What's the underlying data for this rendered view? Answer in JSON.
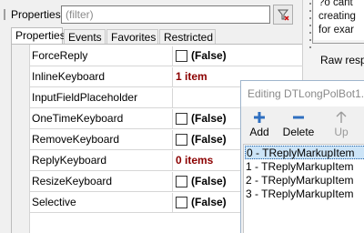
{
  "inspector": {
    "title": "Properties",
    "filter_placeholder": "(filter)",
    "tabs": [
      {
        "label": "Properties",
        "active": true
      },
      {
        "label": "Events",
        "active": false
      },
      {
        "label": "Favorites",
        "active": false
      },
      {
        "label": "Restricted",
        "active": false
      }
    ],
    "rows": [
      {
        "name": "ForceReply",
        "checkbox": true,
        "value": "(False)"
      },
      {
        "name": "InlineKeyboard",
        "checkbox": false,
        "value": "1 item"
      },
      {
        "name": "InputFieldPlaceholder",
        "checkbox": false,
        "value": ""
      },
      {
        "name": "OneTimeKeyboard",
        "checkbox": true,
        "value": "(False)"
      },
      {
        "name": "RemoveKeyboard",
        "checkbox": true,
        "value": "(False)"
      },
      {
        "name": "ReplyKeyboard",
        "checkbox": false,
        "value": "0 items"
      },
      {
        "name": "ResizeKeyboard",
        "checkbox": true,
        "value": "(False)"
      },
      {
        "name": "Selective",
        "checkbox": true,
        "value": "(False)"
      }
    ],
    "colors": {
      "item_count": "#8b0000"
    }
  },
  "background": {
    "memo_lines": [
      "?o cant",
      "creating",
      "for exar"
    ],
    "raw_label": "Raw resp"
  },
  "editor": {
    "title": "Editing DTLongPolBot1.Re",
    "toolbar": {
      "add_label": "Add",
      "delete_label": "Delete",
      "up_label": "Up"
    },
    "items": [
      "0 - TReplyMarkupItem",
      "1 - TReplyMarkupItem",
      "2 - TReplyMarkupItem",
      "3 - TReplyMarkupItem"
    ],
    "selected_index": 0,
    "colors": {
      "selection": "#cce4f7",
      "icon_blue": "#2f6fc0"
    }
  }
}
